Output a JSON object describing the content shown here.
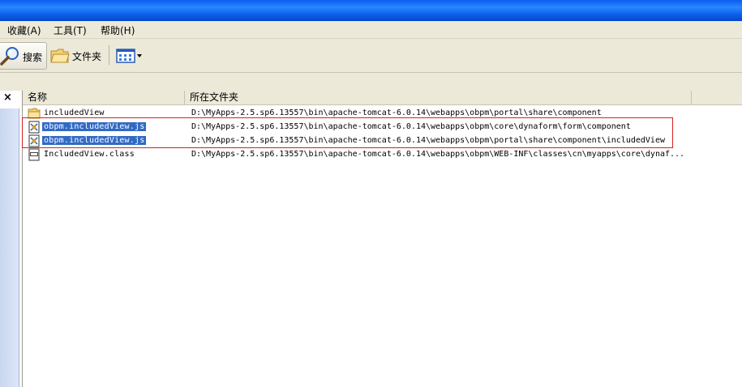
{
  "menu": [
    {
      "label": "收藏(A)"
    },
    {
      "label": "工具(T)"
    },
    {
      "label": "帮助(H)"
    }
  ],
  "toolbar": {
    "search_label": "搜索",
    "folders_label": "文件夹"
  },
  "pane": {
    "close_label": "×"
  },
  "columns": {
    "name": "名称",
    "folder": "所在文件夹"
  },
  "files": [
    {
      "name": "includedView",
      "type": "folder",
      "location": "D:\\MyApps-2.5.sp6.13557\\bin\\apache-tomcat-6.0.14\\webapps\\obpm\\portal\\share\\component",
      "selected": false
    },
    {
      "name": "obpm.includedView.js",
      "type": "js",
      "location": "D:\\MyApps-2.5.sp6.13557\\bin\\apache-tomcat-6.0.14\\webapps\\obpm\\core\\dynaform\\form\\component",
      "selected": true
    },
    {
      "name": "obpm.includedView.js",
      "type": "js",
      "location": "D:\\MyApps-2.5.sp6.13557\\bin\\apache-tomcat-6.0.14\\webapps\\obpm\\portal\\share\\component\\includedView",
      "selected": true
    },
    {
      "name": "IncludedView.class",
      "type": "class",
      "location": "D:\\MyApps-2.5.sp6.13557\\bin\\apache-tomcat-6.0.14\\webapps\\obpm\\WEB-INF\\classes\\cn\\myapps\\core\\dynaf...",
      "selected": false
    }
  ],
  "colors": {
    "selection": "#316ac5",
    "highlight_border": "#d62020",
    "titlebar": "#0b5fe8"
  }
}
